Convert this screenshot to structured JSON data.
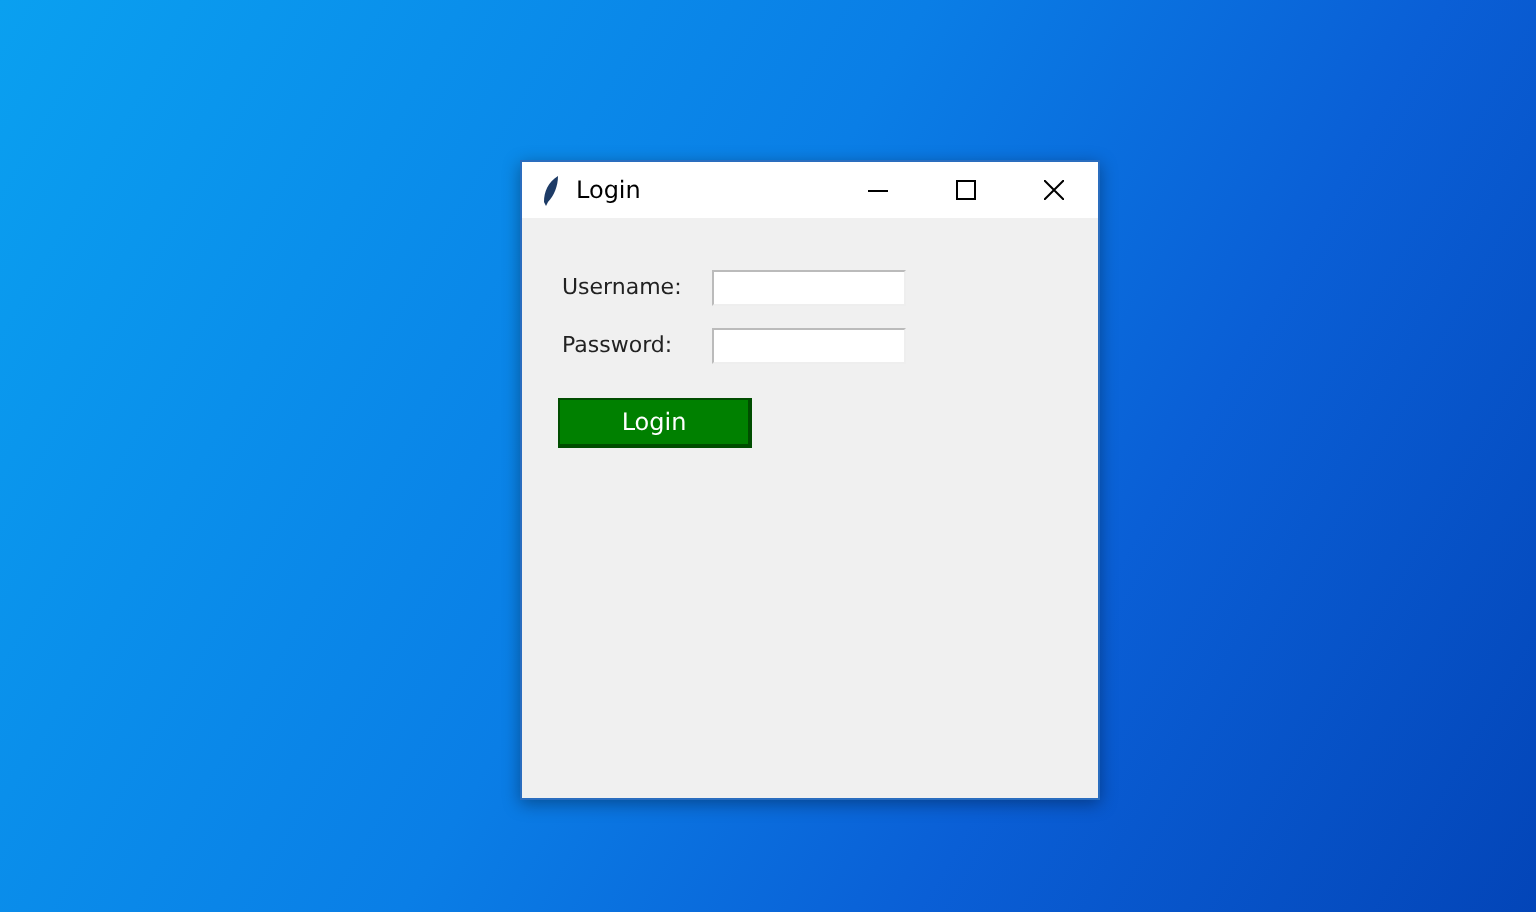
{
  "window": {
    "title": "Login"
  },
  "fields": [
    {
      "label": "Username:"
    },
    {
      "label": "Password:"
    }
  ],
  "button": {
    "label": "Login"
  }
}
